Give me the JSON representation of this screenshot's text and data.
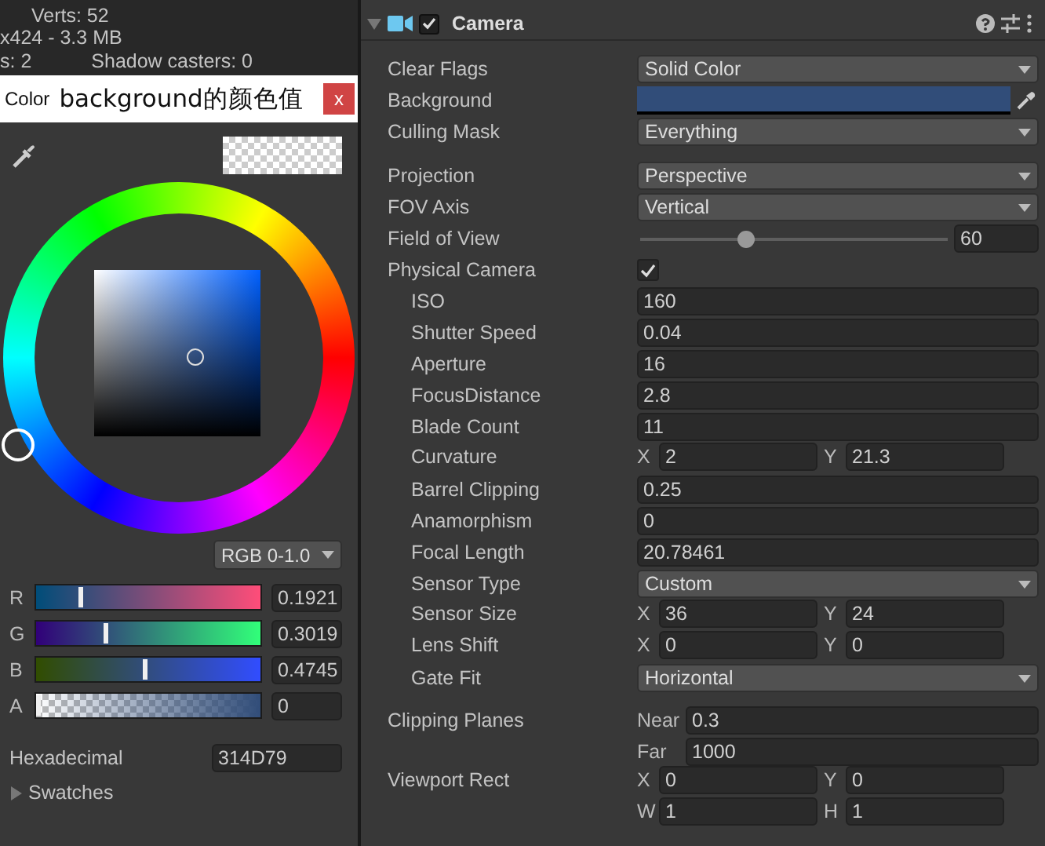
{
  "stats": {
    "lines": [
      {
        "texts": [
          "Verts: 52"
        ]
      },
      {
        "texts": [
          "x424 - 3.3 MB"
        ]
      },
      {
        "texts": [
          "s: 2",
          "Shadow casters: 0"
        ]
      }
    ]
  },
  "color_picker": {
    "title_prefix": "Color",
    "title": "background的颜色值",
    "close": "x",
    "mode": "RGB 0-1.0",
    "channels": [
      {
        "label": "R",
        "level": 0.192,
        "value": "0.1921"
      },
      {
        "label": "G",
        "level": 0.302,
        "value": "0.3019"
      },
      {
        "label": "B",
        "level": 0.4745,
        "value": "0.4745"
      },
      {
        "label": "A",
        "level": 0,
        "value": "0"
      }
    ],
    "hex_label": "Hexadecimal",
    "hex_value": "314D79",
    "swatches": {
      "label": "Swatches",
      "expanded": false
    }
  },
  "inspector": {
    "component": {
      "name": "Camera",
      "enabled": true,
      "expanded": true
    },
    "sections": [
      {
        "properties": [
          {
            "label": "Clear Flags",
            "kind": "dropdown",
            "value": "Solid Color"
          },
          {
            "label": "Background",
            "kind": "color",
            "color": "#314d79"
          },
          {
            "label": "Culling Mask",
            "kind": "dropdown",
            "value": "Everything"
          }
        ]
      },
      {
        "properties": [
          {
            "label": "Projection",
            "kind": "dropdown",
            "value": "Perspective"
          },
          {
            "label": "FOV Axis",
            "kind": "dropdown",
            "value": "Vertical"
          },
          {
            "label": "Field of View",
            "kind": "slider",
            "level": 0.34,
            "value": "60"
          },
          {
            "label": "Physical Camera",
            "kind": "checkbox",
            "checked": true,
            "children": [
              {
                "label": "ISO",
                "kind": "text",
                "value": "160"
              },
              {
                "label": "Shutter Speed",
                "kind": "text",
                "value": "0.04"
              },
              {
                "label": "Aperture",
                "kind": "text",
                "value": "16"
              },
              {
                "label": "FocusDistance",
                "kind": "text",
                "value": "2.8"
              },
              {
                "label": "Blade Count",
                "kind": "text",
                "value": "11"
              },
              {
                "label": "Curvature",
                "kind": "vector",
                "rows": [
                  [
                    {
                      "axis": "X",
                      "value": "2"
                    },
                    {
                      "axis": "Y",
                      "value": "21.3"
                    }
                  ]
                ]
              },
              {
                "label": "Barrel Clipping",
                "kind": "text",
                "value": "0.25"
              },
              {
                "label": "Anamorphism",
                "kind": "text",
                "value": "0"
              },
              {
                "label": "Focal Length",
                "kind": "text",
                "value": "20.78461"
              },
              {
                "label": "Sensor Type",
                "kind": "dropdown",
                "value": "Custom"
              },
              {
                "label": "Sensor Size",
                "kind": "vector",
                "rows": [
                  [
                    {
                      "axis": "X",
                      "value": "36"
                    },
                    {
                      "axis": "Y",
                      "value": "24"
                    }
                  ]
                ]
              },
              {
                "label": "Lens Shift",
                "kind": "vector",
                "rows": [
                  [
                    {
                      "axis": "X",
                      "value": "0"
                    },
                    {
                      "axis": "Y",
                      "value": "0"
                    }
                  ]
                ]
              },
              {
                "label": "Gate Fit",
                "kind": "dropdown",
                "value": "Horizontal"
              }
            ]
          }
        ]
      },
      {
        "properties": [
          {
            "label": "Clipping Planes",
            "kind": "stacked",
            "fields": [
              {
                "label": "Near",
                "value": "0.3"
              },
              {
                "label": "Far",
                "value": "1000"
              }
            ]
          },
          {
            "label": "Viewport Rect",
            "kind": "vector",
            "rows": [
              [
                {
                  "axis": "X",
                  "value": "0"
                },
                {
                  "axis": "Y",
                  "value": "0"
                }
              ],
              [
                {
                  "axis": "W",
                  "value": "1"
                },
                {
                  "axis": "H",
                  "value": "1"
                }
              ]
            ]
          }
        ]
      }
    ]
  }
}
